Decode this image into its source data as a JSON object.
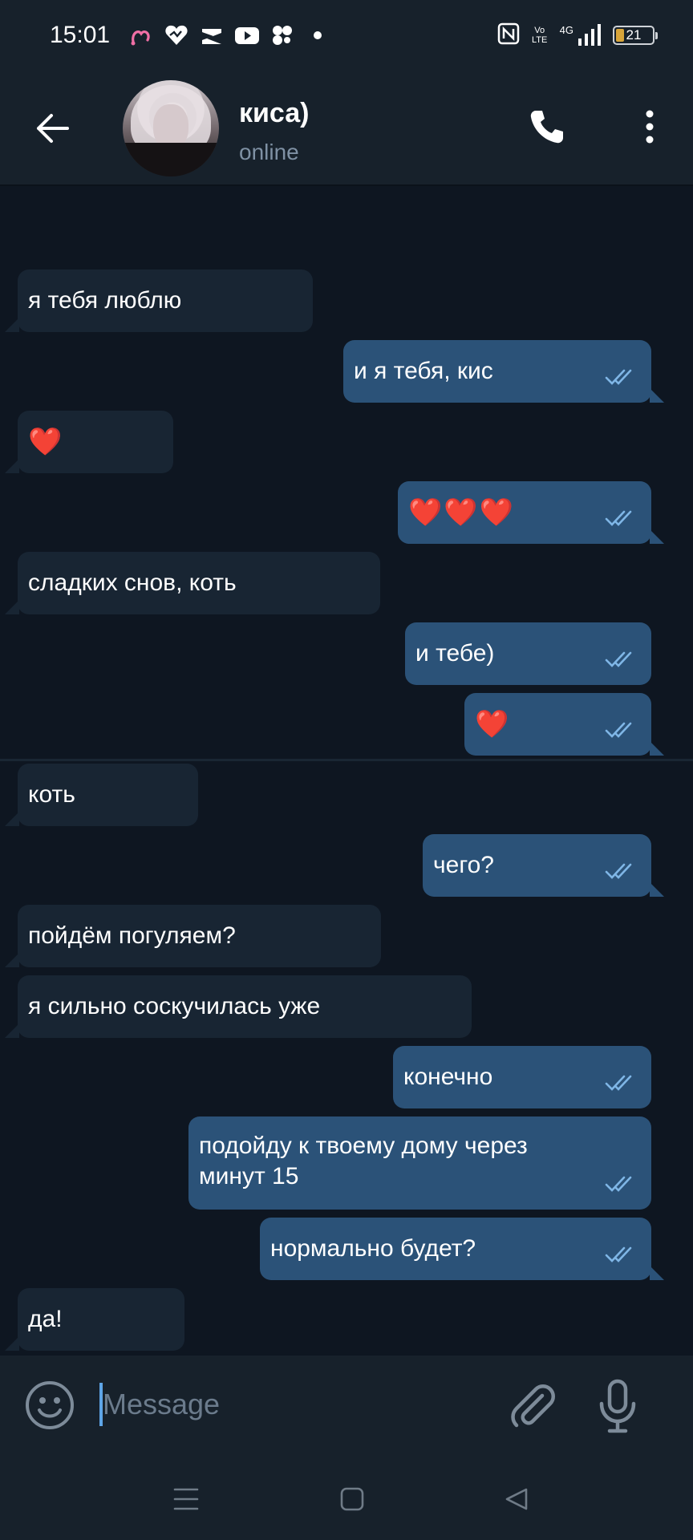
{
  "status_bar": {
    "time": "15:01",
    "battery_level": "21",
    "network": "4G",
    "volte": "Vo LTE",
    "left_icons": [
      "heart-link-icon",
      "heart-app-icon",
      "capcut-icon",
      "youtube-icon",
      "cluster-app-icon",
      "dot-icon"
    ],
    "right_icons": [
      "nfc-icon",
      "volte-icon",
      "signal-4g-icon",
      "battery-icon"
    ]
  },
  "header": {
    "contact_name": "киса)",
    "status": "online"
  },
  "messages": [
    {
      "direction": "in",
      "text": "я тебя люблю"
    },
    {
      "direction": "out",
      "text": "и я тебя, кис",
      "read": true
    },
    {
      "direction": "in",
      "text": "❤️"
    },
    {
      "direction": "out",
      "text": "❤️❤️❤️",
      "read": true
    },
    {
      "direction": "in",
      "text": "сладких снов, коть"
    },
    {
      "direction": "out",
      "text": "и тебе)",
      "read": true
    },
    {
      "direction": "out",
      "text": "❤️",
      "read": true
    },
    {
      "direction": "in",
      "text": "коть"
    },
    {
      "direction": "out",
      "text": "чего?",
      "read": true
    },
    {
      "direction": "in",
      "text": "пойдём погуляем?"
    },
    {
      "direction": "in",
      "text": "я сильно соскучилась уже"
    },
    {
      "direction": "out",
      "text": "конечно",
      "read": true
    },
    {
      "direction": "out",
      "text": "подойду к твоему дому через минут 15",
      "read": true
    },
    {
      "direction": "out",
      "text": "нормально будет?",
      "read": true
    },
    {
      "direction": "in",
      "text": "да!"
    }
  ],
  "input": {
    "placeholder": "Message",
    "value": ""
  },
  "colors": {
    "background": "#0e1621",
    "header": "#17212b",
    "incoming_bubble": "#182533",
    "outgoing_bubble": "#2b5278",
    "read_checks": "#7fb6e6",
    "accent": "#5ea5e7"
  }
}
